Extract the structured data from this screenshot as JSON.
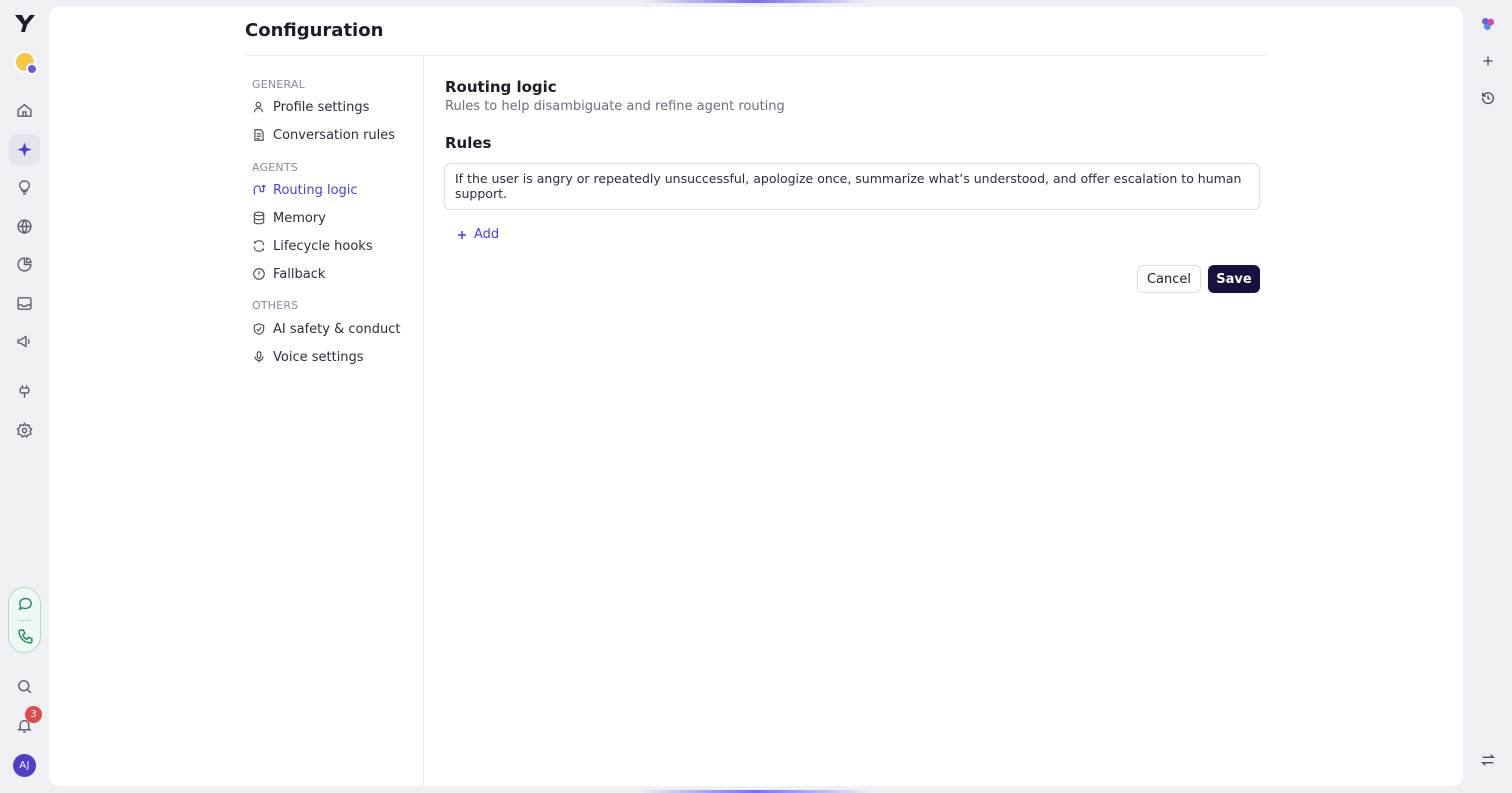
{
  "page": {
    "title": "Configuration"
  },
  "nav": {
    "sections": [
      {
        "label": "GENERAL",
        "items": [
          {
            "label": "Profile settings",
            "icon": "user-icon"
          },
          {
            "label": "Conversation rules",
            "icon": "document-list-icon"
          }
        ]
      },
      {
        "label": "AGENTS",
        "items": [
          {
            "label": "Routing logic",
            "icon": "route-icon",
            "active": true
          },
          {
            "label": "Memory",
            "icon": "database-icon"
          },
          {
            "label": "Lifecycle hooks",
            "icon": "refresh-icon"
          },
          {
            "label": "Fallback",
            "icon": "alert-circle-icon"
          }
        ]
      },
      {
        "label": "OTHERS",
        "items": [
          {
            "label": "AI safety & conduct",
            "icon": "shield-check-icon"
          },
          {
            "label": "Voice settings",
            "icon": "microphone-icon"
          }
        ]
      }
    ]
  },
  "content": {
    "section_title": "Routing logic",
    "section_subtitle": "Rules to help disambiguate and refine agent routing",
    "rules_title": "Rules",
    "rules": [
      "If the user is angry or repeatedly unsuccessful, apologize once, summarize what’s understood, and offer escalation to human support."
    ],
    "add_label": "Add",
    "cancel_label": "Cancel",
    "save_label": "Save"
  },
  "left_rail": {
    "notification_count": "3",
    "user_initials": "AJ"
  },
  "colors": {
    "accent": "#4b3fd6",
    "save_button": "#17123d",
    "badge": "#e34b4b"
  }
}
